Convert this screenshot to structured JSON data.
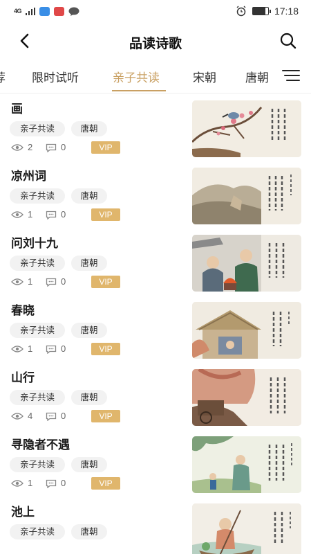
{
  "status_bar": {
    "network": "4G",
    "time": "17:18",
    "battery_level": 0.8
  },
  "header": {
    "title": "品读诗歌",
    "back_icon": "chevron-left-icon",
    "search_icon": "search-icon"
  },
  "tabs": {
    "items": [
      {
        "label": "荐"
      },
      {
        "label": "限时试听"
      },
      {
        "label": "亲子共读"
      },
      {
        "label": "宋朝"
      },
      {
        "label": "唐朝"
      }
    ],
    "active_index": 2,
    "menu_icon": "menu-icon"
  },
  "colors": {
    "accent": "#c9a063",
    "vip": "#e0b66c",
    "tag_bg": "#f2f2f2"
  },
  "items": [
    {
      "title": "画",
      "tags": [
        "亲子共读",
        "唐朝"
      ],
      "views": "2",
      "comments": "0",
      "badge": "VIP",
      "thumb_text": "人来鸟不惊 春去花还在 画"
    },
    {
      "title": "凉州词",
      "tags": [
        "亲子共读",
        "唐朝"
      ],
      "views": "1",
      "comments": "0",
      "badge": "VIP",
      "thumb_text": "一片孤城万仞山 黄河远上白云间 凉州词"
    },
    {
      "title": "问刘十九",
      "tags": [
        "亲子共读",
        "唐朝"
      ],
      "views": "1",
      "comments": "0",
      "badge": "VIP",
      "thumb_text": "红泥小火炉 绿蚁新醅酒 问刘十九"
    },
    {
      "title": "春晓",
      "tags": [
        "亲子共读",
        "唐朝"
      ],
      "views": "1",
      "comments": "0",
      "badge": "VIP",
      "thumb_text": "花落知多少 夜来风雨声 春晓"
    },
    {
      "title": "山行",
      "tags": [
        "亲子共读",
        "唐朝"
      ],
      "views": "4",
      "comments": "0",
      "badge": "VIP",
      "thumb_text": "霜叶红于二月花 停车坐爱枫林晚 山行"
    },
    {
      "title": "寻隐者不遇",
      "tags": [
        "亲子共读",
        "唐朝"
      ],
      "views": "1",
      "comments": "0",
      "badge": "VIP",
      "thumb_text": "云深不知处 只在此山中 寻隐者不遇"
    },
    {
      "title": "池上",
      "tags": [
        "亲子共读",
        "唐朝"
      ],
      "views": "",
      "comments": "",
      "badge": "",
      "thumb_text": "偷采白莲回 小娃撑小艇 池上"
    }
  ]
}
